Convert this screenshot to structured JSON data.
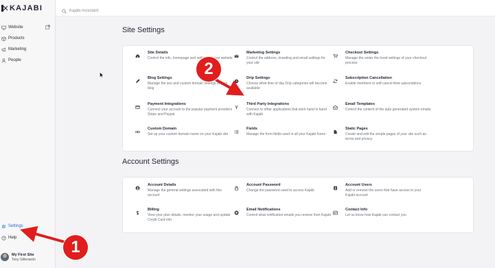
{
  "app": {
    "brand": "KAJABI"
  },
  "sidebar": {
    "items": [
      {
        "label": "Website",
        "icon": "monitor-icon"
      },
      {
        "label": "Products",
        "icon": "box-icon"
      },
      {
        "label": "Marketing",
        "icon": "megaphone-icon"
      },
      {
        "label": "People",
        "icon": "person-icon"
      }
    ],
    "settings_label": "Settings",
    "help_label": "Help",
    "account": {
      "site": "My First Site",
      "user": "Tony Gillenardo"
    }
  },
  "search": {
    "placeholder": "Kajabi Assistant"
  },
  "site_settings": {
    "title": "Site Settings",
    "items": [
      {
        "title": "Site Details",
        "desc": "Control the info, homepage and settings of your website",
        "icon": "home-icon"
      },
      {
        "title": "Marketing Settings",
        "desc": "Control the address, branding and email settings for your site",
        "icon": "envelope-icon"
      },
      {
        "title": "Checkout Settings",
        "desc": "Manage the under the hood settings of your checkout process",
        "icon": "cart-icon"
      },
      {
        "title": "Blog Settings",
        "desc": "Manage the seo and custom domain settings of your blog",
        "icon": "pencil-icon"
      },
      {
        "title": "Drip Settings",
        "desc": "Choose what time of day Drip categories will become available",
        "icon": "clock-icon"
      },
      {
        "title": "Subscription Cancellation",
        "desc": "Enable members to self-cancel their subscriptions",
        "icon": "refresh-icon"
      },
      {
        "title": "Payment Integrations",
        "desc": "Connect your account to the popular payment providers Stripe and Paypal",
        "icon": "credit-card-icon"
      },
      {
        "title": "Third Party Integrations",
        "desc": "Connect to other applications that work hand in hand with Kajabi",
        "icon": "plug-icon"
      },
      {
        "title": "Email Templates",
        "desc": "Control the content of the auto generated system emails",
        "icon": "mail-template-icon"
      },
      {
        "title": "Custom Domain",
        "desc": "Set up your custom domain name on your Kajabi site",
        "icon": "link-icon"
      },
      {
        "title": "Fields",
        "desc": "Manage the form fields used in all your Kajabi forms",
        "icon": "fields-icon"
      },
      {
        "title": "Static Pages",
        "desc": "Create and edit the simple pages of your site such as terms and privacy",
        "icon": "page-icon"
      }
    ]
  },
  "account_settings": {
    "title": "Account Settings",
    "items": [
      {
        "title": "Account Details",
        "desc": "Manage the general settings associated with this account",
        "icon": "user-circle-icon"
      },
      {
        "title": "Account Password",
        "desc": "Change the password used to access Kajabi",
        "icon": "lock-icon"
      },
      {
        "title": "Account Users",
        "desc": "Add or remove the users that have access to your Kajabi account",
        "icon": "users-icon"
      },
      {
        "title": "Billing",
        "desc": "View your plan details, monitor your usage and update Credit Card info",
        "icon": "dollar-icon"
      },
      {
        "title": "Email Notifications",
        "desc": "Control what notification emails you recieve from Kajabi",
        "icon": "bell-icon"
      },
      {
        "title": "Contact Info",
        "desc": "Let us know how Kajabi can contact you",
        "icon": "contact-card-icon"
      }
    ]
  },
  "annotations": {
    "badge_1": "1",
    "badge_2": "2",
    "color": "#e11d1d"
  }
}
